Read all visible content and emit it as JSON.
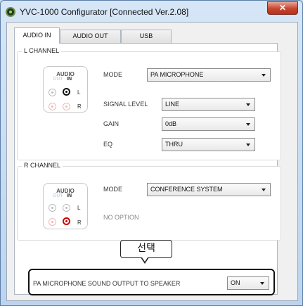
{
  "window": {
    "title": "YVC-1000 Configurator   [Connected  Ver.2.08]",
    "close_glyph": "✕"
  },
  "tabs": [
    {
      "label": "AUDIO IN",
      "active": true
    },
    {
      "label": "AUDIO OUT",
      "active": false
    },
    {
      "label": "USB",
      "active": false
    }
  ],
  "l_channel": {
    "group_label": "L CHANNEL",
    "jack_panel": {
      "audio": "AUDIO",
      "out": "OUT",
      "in": "IN",
      "l": "L",
      "r": "R",
      "selected": "IN-L"
    },
    "mode": {
      "label": "MODE",
      "value": "PA MICROPHONE"
    },
    "signal_level": {
      "label": "SIGNAL LEVEL",
      "value": "LINE"
    },
    "gain": {
      "label": "GAIN",
      "value": "0dB"
    },
    "eq": {
      "label": "EQ",
      "value": "THRU"
    }
  },
  "r_channel": {
    "group_label": "R CHANNEL",
    "jack_panel": {
      "audio": "AUDIO",
      "out": "OUT",
      "in": "IN",
      "l": "L",
      "r": "R",
      "selected": "IN-R"
    },
    "mode": {
      "label": "MODE",
      "value": "CONFERENCE SYSTEM"
    },
    "no_option": "NO OPTION"
  },
  "callout": {
    "text": "선택"
  },
  "speaker_output": {
    "label": "PA MICROPHONE SOUND OUTPUT TO SPEAKER",
    "value": "ON"
  },
  "colors": {
    "accent_red": "#cc0000",
    "frame": "#bcd4ee"
  }
}
